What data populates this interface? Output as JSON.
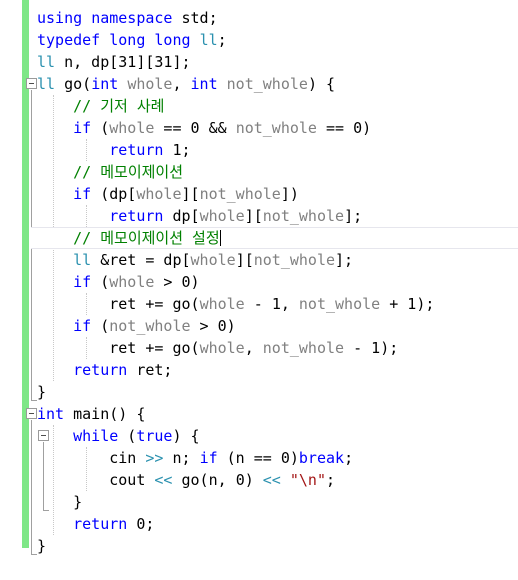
{
  "editor": {
    "language": "cpp",
    "colors": {
      "background": "#ffffff",
      "keyword": "#0000ff",
      "type": "#2b91af",
      "parameter": "#808080",
      "comment": "#008000",
      "string": "#a31515",
      "operator": "#2b91af",
      "plain": "#000000",
      "change_bar": "#7ee787",
      "current_line_border": "#e6e6ed",
      "indent_guide": "#c8c8c8",
      "fold_marker": "#9a9a9a"
    },
    "current_line_index": 10,
    "caret_line_text": "// 메모이제이션 설정"
  },
  "gutter": {
    "change_bar_present": true,
    "fold_markers": [
      {
        "line": 3,
        "state": "expanded",
        "icon": "fold-minus-icon"
      },
      {
        "line": 18,
        "state": "expanded",
        "icon": "fold-minus-icon"
      },
      {
        "line": 19,
        "state": "expanded",
        "icon": "fold-minus-icon"
      }
    ]
  },
  "code": {
    "lines": [
      {
        "index": 0,
        "tokens": [
          {
            "t": "using",
            "c": "kw"
          },
          {
            "t": " ",
            "c": "pln"
          },
          {
            "t": "namespace",
            "c": "kw"
          },
          {
            "t": " ",
            "c": "pln"
          },
          {
            "t": "std",
            "c": "pln"
          },
          {
            "t": ";",
            "c": "pln"
          }
        ]
      },
      {
        "index": 1,
        "tokens": [
          {
            "t": "typedef",
            "c": "kw"
          },
          {
            "t": " ",
            "c": "pln"
          },
          {
            "t": "long",
            "c": "kw"
          },
          {
            "t": " ",
            "c": "pln"
          },
          {
            "t": "long",
            "c": "kw"
          },
          {
            "t": " ",
            "c": "pln"
          },
          {
            "t": "ll",
            "c": "typ"
          },
          {
            "t": ";",
            "c": "pln"
          }
        ]
      },
      {
        "index": 2,
        "tokens": [
          {
            "t": "ll",
            "c": "typ"
          },
          {
            "t": " n, dp[",
            "c": "pln"
          },
          {
            "t": "31",
            "c": "num"
          },
          {
            "t": "][",
            "c": "pln"
          },
          {
            "t": "31",
            "c": "num"
          },
          {
            "t": "];",
            "c": "pln"
          }
        ]
      },
      {
        "index": 3,
        "tokens": [
          {
            "t": "ll",
            "c": "typ"
          },
          {
            "t": " go(",
            "c": "pln"
          },
          {
            "t": "int",
            "c": "kw"
          },
          {
            "t": " ",
            "c": "pln"
          },
          {
            "t": "whole",
            "c": "par"
          },
          {
            "t": ", ",
            "c": "pln"
          },
          {
            "t": "int",
            "c": "kw"
          },
          {
            "t": " ",
            "c": "pln"
          },
          {
            "t": "not_whole",
            "c": "par"
          },
          {
            "t": ") {",
            "c": "pln"
          }
        ]
      },
      {
        "index": 4,
        "indent": 1,
        "tokens": [
          {
            "t": "    ",
            "c": "pln"
          },
          {
            "t": "// 기저 사례",
            "c": "cmt"
          }
        ]
      },
      {
        "index": 5,
        "indent": 1,
        "tokens": [
          {
            "t": "    ",
            "c": "pln"
          },
          {
            "t": "if",
            "c": "kw"
          },
          {
            "t": " (",
            "c": "pln"
          },
          {
            "t": "whole",
            "c": "par"
          },
          {
            "t": " == ",
            "c": "pln"
          },
          {
            "t": "0",
            "c": "num"
          },
          {
            "t": " && ",
            "c": "pln"
          },
          {
            "t": "not_whole",
            "c": "par"
          },
          {
            "t": " == ",
            "c": "pln"
          },
          {
            "t": "0",
            "c": "num"
          },
          {
            "t": ")",
            "c": "pln"
          }
        ]
      },
      {
        "index": 6,
        "indent": 2,
        "tokens": [
          {
            "t": "        ",
            "c": "pln"
          },
          {
            "t": "return",
            "c": "kw"
          },
          {
            "t": " ",
            "c": "pln"
          },
          {
            "t": "1",
            "c": "num"
          },
          {
            "t": ";",
            "c": "pln"
          }
        ]
      },
      {
        "index": 7,
        "indent": 1,
        "tokens": [
          {
            "t": "    ",
            "c": "pln"
          },
          {
            "t": "// 메모이제이션",
            "c": "cmt"
          }
        ]
      },
      {
        "index": 8,
        "indent": 1,
        "tokens": [
          {
            "t": "    ",
            "c": "pln"
          },
          {
            "t": "if",
            "c": "kw"
          },
          {
            "t": " (dp[",
            "c": "pln"
          },
          {
            "t": "whole",
            "c": "par"
          },
          {
            "t": "][",
            "c": "pln"
          },
          {
            "t": "not_whole",
            "c": "par"
          },
          {
            "t": "])",
            "c": "pln"
          }
        ]
      },
      {
        "index": 9,
        "indent": 2,
        "tokens": [
          {
            "t": "        ",
            "c": "pln"
          },
          {
            "t": "return",
            "c": "kw"
          },
          {
            "t": " dp[",
            "c": "pln"
          },
          {
            "t": "whole",
            "c": "par"
          },
          {
            "t": "][",
            "c": "pln"
          },
          {
            "t": "not_whole",
            "c": "par"
          },
          {
            "t": "];",
            "c": "pln"
          }
        ]
      },
      {
        "index": 10,
        "indent": 1,
        "current": true,
        "tokens": [
          {
            "t": "    ",
            "c": "pln"
          },
          {
            "t": "// 메모이제이션 설정",
            "c": "cmt"
          }
        ]
      },
      {
        "index": 11,
        "indent": 1,
        "tokens": [
          {
            "t": "    ",
            "c": "pln"
          },
          {
            "t": "ll",
            "c": "typ"
          },
          {
            "t": " &ret = dp[",
            "c": "pln"
          },
          {
            "t": "whole",
            "c": "par"
          },
          {
            "t": "][",
            "c": "pln"
          },
          {
            "t": "not_whole",
            "c": "par"
          },
          {
            "t": "];",
            "c": "pln"
          }
        ]
      },
      {
        "index": 12,
        "indent": 1,
        "tokens": [
          {
            "t": "    ",
            "c": "pln"
          },
          {
            "t": "if",
            "c": "kw"
          },
          {
            "t": " (",
            "c": "pln"
          },
          {
            "t": "whole",
            "c": "par"
          },
          {
            "t": " > ",
            "c": "pln"
          },
          {
            "t": "0",
            "c": "num"
          },
          {
            "t": ")",
            "c": "pln"
          }
        ]
      },
      {
        "index": 13,
        "indent": 2,
        "tokens": [
          {
            "t": "        ret += go(",
            "c": "pln"
          },
          {
            "t": "whole",
            "c": "par"
          },
          {
            "t": " - ",
            "c": "pln"
          },
          {
            "t": "1",
            "c": "num"
          },
          {
            "t": ", ",
            "c": "pln"
          },
          {
            "t": "not_whole",
            "c": "par"
          },
          {
            "t": " + ",
            "c": "pln"
          },
          {
            "t": "1",
            "c": "num"
          },
          {
            "t": ");",
            "c": "pln"
          }
        ]
      },
      {
        "index": 14,
        "indent": 1,
        "tokens": [
          {
            "t": "    ",
            "c": "pln"
          },
          {
            "t": "if",
            "c": "kw"
          },
          {
            "t": " (",
            "c": "pln"
          },
          {
            "t": "not_whole",
            "c": "par"
          },
          {
            "t": " > ",
            "c": "pln"
          },
          {
            "t": "0",
            "c": "num"
          },
          {
            "t": ")",
            "c": "pln"
          }
        ]
      },
      {
        "index": 15,
        "indent": 2,
        "tokens": [
          {
            "t": "        ret += go(",
            "c": "pln"
          },
          {
            "t": "whole",
            "c": "par"
          },
          {
            "t": ", ",
            "c": "pln"
          },
          {
            "t": "not_whole",
            "c": "par"
          },
          {
            "t": " - ",
            "c": "pln"
          },
          {
            "t": "1",
            "c": "num"
          },
          {
            "t": ");",
            "c": "pln"
          }
        ]
      },
      {
        "index": 16,
        "indent": 1,
        "tokens": [
          {
            "t": "    ",
            "c": "pln"
          },
          {
            "t": "return",
            "c": "kw"
          },
          {
            "t": " ret;",
            "c": "pln"
          }
        ]
      },
      {
        "index": 17,
        "tokens": [
          {
            "t": "}",
            "c": "pln"
          }
        ]
      },
      {
        "index": 18,
        "tokens": [
          {
            "t": "int",
            "c": "kw"
          },
          {
            "t": " main() {",
            "c": "pln"
          }
        ]
      },
      {
        "index": 19,
        "indent": 1,
        "tokens": [
          {
            "t": "    ",
            "c": "pln"
          },
          {
            "t": "while",
            "c": "kw"
          },
          {
            "t": " (",
            "c": "pln"
          },
          {
            "t": "true",
            "c": "kw"
          },
          {
            "t": ") {",
            "c": "pln"
          }
        ]
      },
      {
        "index": 20,
        "indent": 2,
        "tokens": [
          {
            "t": "        cin ",
            "c": "pln"
          },
          {
            "t": ">>",
            "c": "op"
          },
          {
            "t": " n; ",
            "c": "pln"
          },
          {
            "t": "if",
            "c": "kw"
          },
          {
            "t": " (n == ",
            "c": "pln"
          },
          {
            "t": "0",
            "c": "num"
          },
          {
            "t": ")",
            "c": "pln"
          },
          {
            "t": "break",
            "c": "kw"
          },
          {
            "t": ";",
            "c": "pln"
          }
        ]
      },
      {
        "index": 21,
        "indent": 2,
        "tokens": [
          {
            "t": "        cout ",
            "c": "pln"
          },
          {
            "t": "<<",
            "c": "op"
          },
          {
            "t": " go(n, ",
            "c": "pln"
          },
          {
            "t": "0",
            "c": "num"
          },
          {
            "t": ") ",
            "c": "pln"
          },
          {
            "t": "<<",
            "c": "op"
          },
          {
            "t": " ",
            "c": "pln"
          },
          {
            "t": "\"\\n\"",
            "c": "str"
          },
          {
            "t": ";",
            "c": "pln"
          }
        ]
      },
      {
        "index": 22,
        "indent": 1,
        "tokens": [
          {
            "t": "    }",
            "c": "pln"
          }
        ]
      },
      {
        "index": 23,
        "indent": 1,
        "tokens": [
          {
            "t": "    ",
            "c": "pln"
          },
          {
            "t": "return",
            "c": "kw"
          },
          {
            "t": " ",
            "c": "pln"
          },
          {
            "t": "0",
            "c": "num"
          },
          {
            "t": ";",
            "c": "pln"
          }
        ]
      },
      {
        "index": 24,
        "tokens": [
          {
            "t": "}",
            "c": "pln"
          }
        ]
      }
    ]
  }
}
